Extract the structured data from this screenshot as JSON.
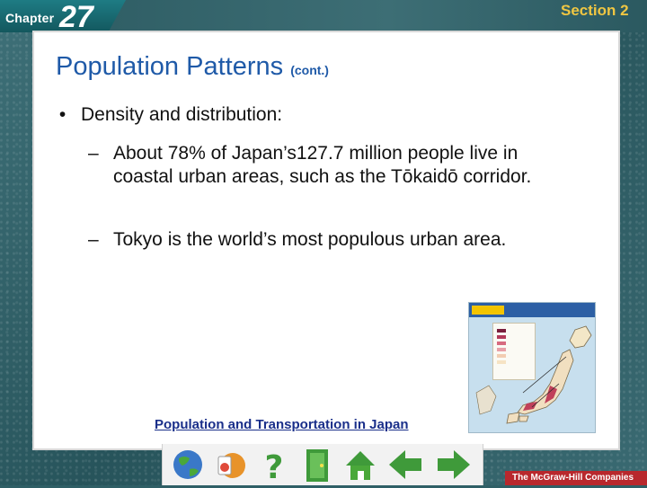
{
  "header": {
    "chapter_label": "Chapter",
    "chapter_number": "27",
    "section_label": "Section 2"
  },
  "slide": {
    "title": "Population Patterns",
    "title_suffix": "(cont.)",
    "bullet": "Density and distribution:",
    "subpoints": [
      "About 78% of Japan’s127.7 million people live in coastal urban areas, such as the Tōkaidō corridor.",
      "Tokyo is the world’s most populous urban area."
    ]
  },
  "map": {
    "caption_link": "Population and Transportation in Japan"
  },
  "nav": {
    "buttons": [
      "globe-button",
      "resources-button",
      "help-button",
      "exit-button",
      "home-button",
      "back-button",
      "forward-button"
    ]
  },
  "footer": {
    "publisher": "The McGraw-Hill Companies"
  },
  "colors": {
    "title_blue": "#1f5aa8",
    "section_gold": "#f0c642",
    "nav_green": "#4aa83a",
    "frame_teal": "#2f5f66"
  }
}
